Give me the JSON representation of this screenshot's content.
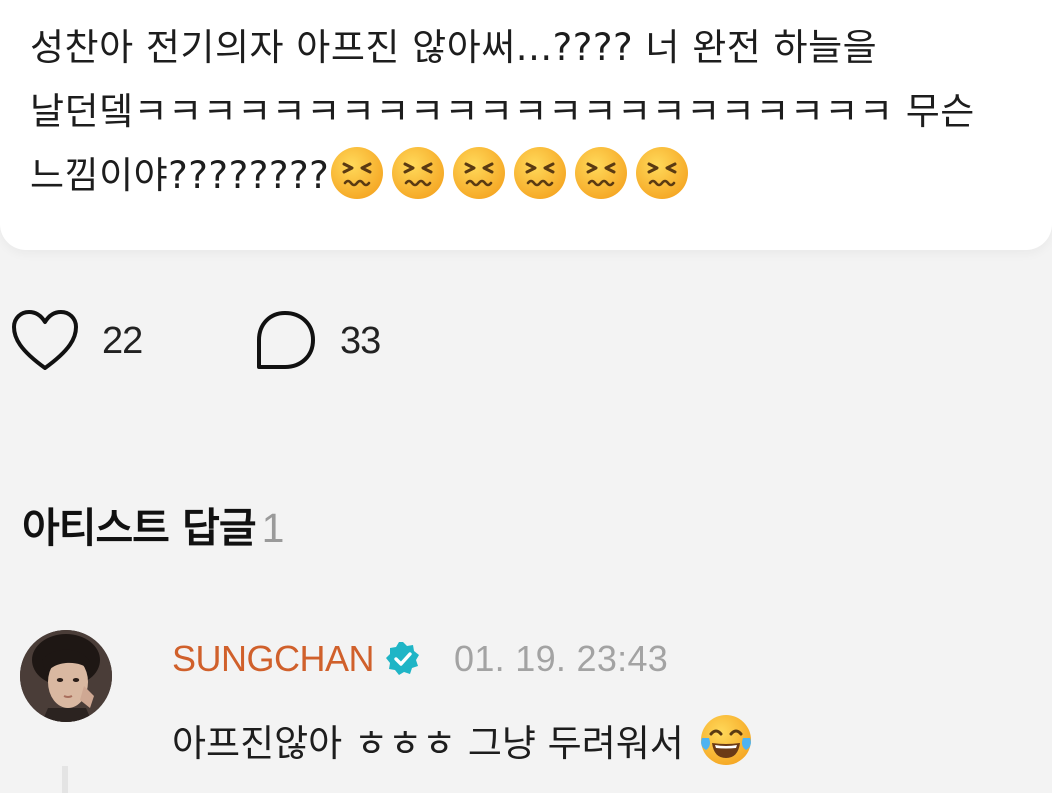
{
  "post": {
    "line1": "성찬아 전기의자 아프진 않아써...???? 너 완전 하늘을",
    "line2": "날던뎈ㅋㅋㅋㅋㅋㅋㅋㅋㅋㅋㅋㅋㅋㅋㅋㅋㅋㅋㅋㅋㅋㅋ 무슨",
    "line3": "느낌이야????????",
    "emojis": [
      "confounded-face",
      "confounded-face",
      "confounded-face",
      "confounded-face",
      "confounded-face",
      "confounded-face"
    ]
  },
  "reactions": {
    "like_count": "22",
    "comment_count": "33"
  },
  "artist_replies": {
    "title": "아티스트 답글",
    "count": "1"
  },
  "reply": {
    "author": "SUNGCHAN",
    "timestamp": "01. 19. 23:43",
    "text": "아프진않아 ㅎㅎㅎ 그냥 두려워서",
    "emoji": "face-with-tears-of-joy"
  },
  "colors": {
    "author": "#d0602b",
    "verified": "#1fb5c6",
    "muted": "#a3a3a3"
  }
}
